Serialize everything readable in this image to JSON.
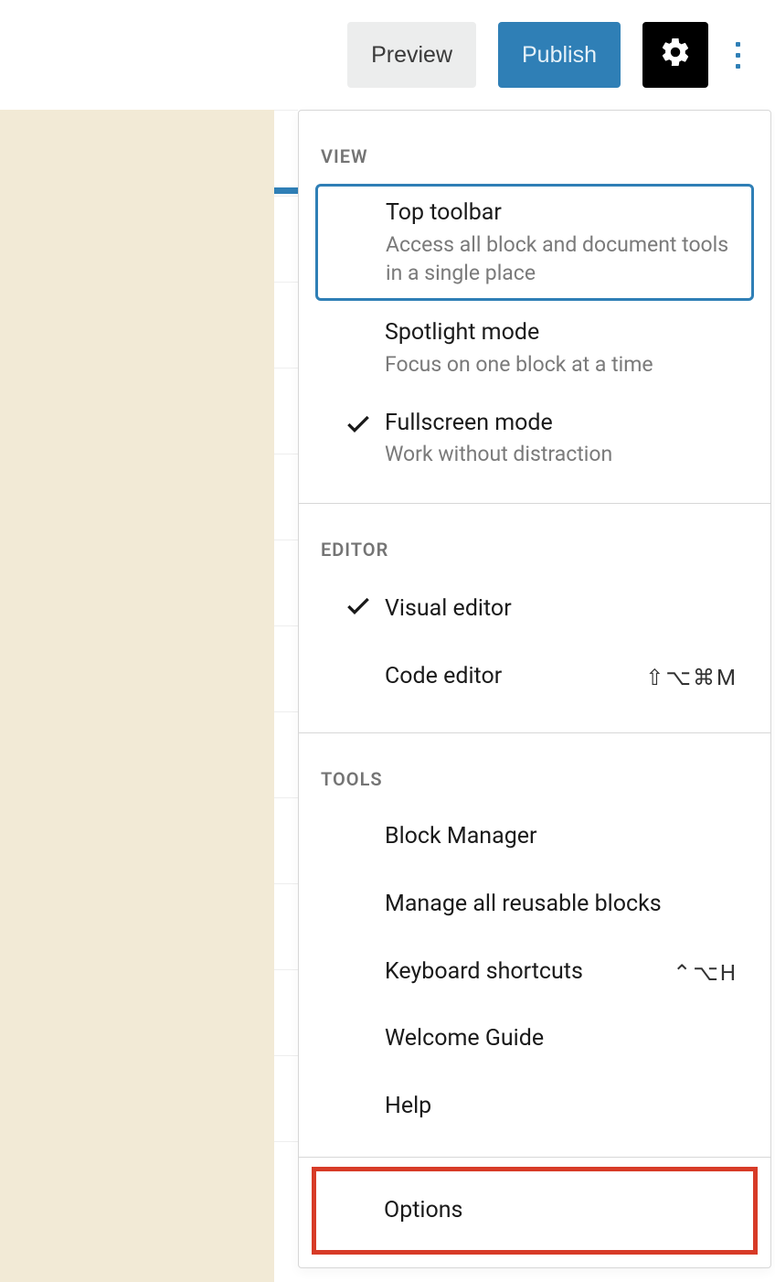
{
  "topbar": {
    "preview": "Preview",
    "publish": "Publish"
  },
  "sections": {
    "view": {
      "label": "VIEW",
      "items": [
        {
          "title": "Top toolbar",
          "desc": "Access all block and document tools in a single place",
          "checked": false,
          "highlighted": true
        },
        {
          "title": "Spotlight mode",
          "desc": "Focus on one block at a time",
          "checked": false,
          "highlighted": false
        },
        {
          "title": "Fullscreen mode",
          "desc": "Work without distraction",
          "checked": true,
          "highlighted": false
        }
      ]
    },
    "editor": {
      "label": "EDITOR",
      "items": [
        {
          "title": "Visual editor",
          "checked": true,
          "shortcut": ""
        },
        {
          "title": "Code editor",
          "checked": false,
          "shortcut": "⇧⌥⌘M"
        }
      ]
    },
    "tools": {
      "label": "TOOLS",
      "items": [
        {
          "title": "Block Manager",
          "shortcut": ""
        },
        {
          "title": "Manage all reusable blocks",
          "shortcut": ""
        },
        {
          "title": "Keyboard shortcuts",
          "shortcut": "⌃⌥H"
        },
        {
          "title": "Welcome Guide",
          "shortcut": ""
        },
        {
          "title": "Help",
          "shortcut": ""
        }
      ]
    },
    "options": {
      "title": "Options"
    }
  }
}
